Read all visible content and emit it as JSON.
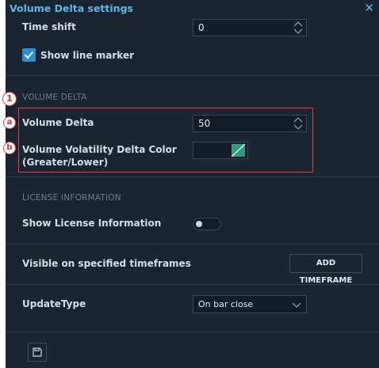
{
  "dialog": {
    "title": "Volume Delta settings"
  },
  "time_shift": {
    "label": "Time shift",
    "value": "0"
  },
  "show_line_marker": {
    "label": "Show line marker"
  },
  "volume_delta_section": {
    "heading": "VOLUME DELTA",
    "volume_delta": {
      "label": "Volume Delta",
      "value": "50"
    },
    "color": {
      "label_line1": "Volume Volatility Delta Color",
      "label_line2": "(Greater/Lower)",
      "upper_color": "#141c27",
      "lower_color": "#26a07e"
    }
  },
  "license_section": {
    "heading": "LICENSE INFORMATION",
    "show_license": {
      "label": "Show License Information"
    }
  },
  "timeframes": {
    "label": "Visible on specified timeframes",
    "button": "ADD TIMEFRAME"
  },
  "update_type": {
    "label": "UpdateType",
    "value": "On bar close"
  },
  "annotations": {
    "marker_1": "1",
    "marker_a": "a",
    "marker_b": "b",
    "highlight_color": "#e04040"
  },
  "colors": {
    "accent": "#5ab7e6",
    "panel": "#1b2431",
    "checkbox": "#2b8fcf"
  }
}
